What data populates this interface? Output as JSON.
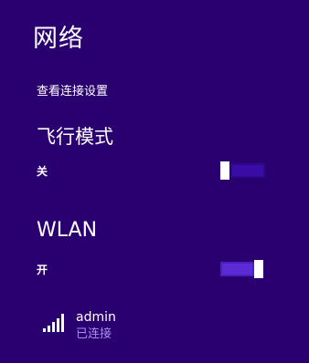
{
  "panel": {
    "title": "网络",
    "view_settings_link": "查看连接设置"
  },
  "airplane_mode": {
    "title": "飞行模式",
    "state_label": "关",
    "enabled": false
  },
  "wlan": {
    "title": "WLAN",
    "state_label": "开",
    "enabled": true
  },
  "networks": [
    {
      "name": "admin",
      "status": "已连接",
      "icon": "wifi-signal-icon",
      "signal_bars": 5
    }
  ],
  "colors": {
    "background": "#2a0070",
    "toggle_on": "#5b2bd6",
    "toggle_off": "#3a0ca6",
    "status_text": "#a98ef0"
  }
}
